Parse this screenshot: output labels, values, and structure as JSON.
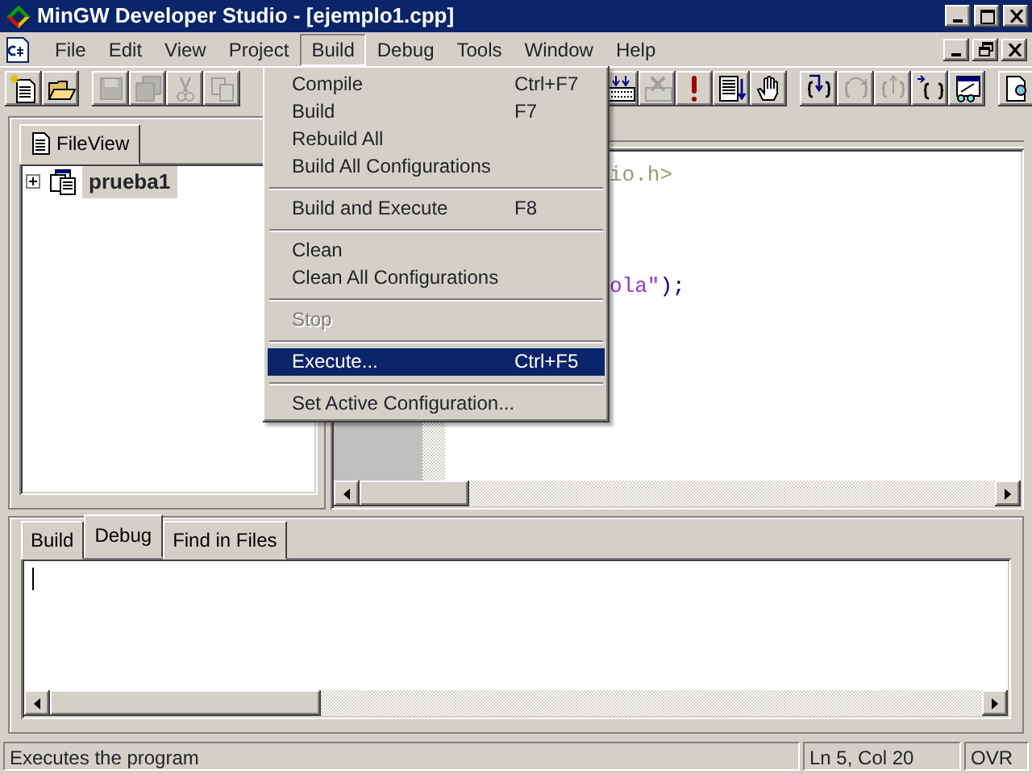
{
  "window": {
    "title": "MinGW Developer Studio - [ejemplo1.cpp]"
  },
  "menu_bar": [
    {
      "label": "File",
      "selected": false
    },
    {
      "label": "Edit",
      "selected": false
    },
    {
      "label": "View",
      "selected": false
    },
    {
      "label": "Project",
      "selected": false
    },
    {
      "label": "Build",
      "selected": true
    },
    {
      "label": "Debug",
      "selected": false
    },
    {
      "label": "Tools",
      "selected": false
    },
    {
      "label": "Window",
      "selected": false
    },
    {
      "label": "Help",
      "selected": false
    }
  ],
  "toolbar_left": [
    {
      "kind": "new",
      "disabled": false
    },
    {
      "kind": "open",
      "disabled": false
    },
    {
      "kind": "save",
      "disabled": true
    },
    {
      "kind": "saveall",
      "disabled": true
    },
    {
      "kind": "cut",
      "disabled": true
    },
    {
      "kind": "copy",
      "disabled": true
    }
  ],
  "toolbar_right": [
    {
      "kind": "build",
      "disabled": false
    },
    {
      "kind": "stopbuild",
      "disabled": true
    },
    {
      "kind": "execute",
      "disabled": false
    },
    {
      "kind": "docdown",
      "disabled": false
    },
    {
      "kind": "hand",
      "disabled": false
    },
    {
      "kind": "stepinto",
      "disabled": false
    },
    {
      "kind": "stepover",
      "disabled": true
    },
    {
      "kind": "stepout",
      "disabled": true
    },
    {
      "kind": "runcursor",
      "disabled": false
    },
    {
      "kind": "watch",
      "disabled": false
    },
    {
      "kind": "page",
      "disabled": false
    }
  ],
  "build_menu": [
    {
      "kind": "item",
      "label": "Compile",
      "shortcut": "Ctrl+F7",
      "disabled": false,
      "selected": false
    },
    {
      "kind": "item",
      "label": "Build",
      "shortcut": "F7",
      "disabled": false,
      "selected": false
    },
    {
      "kind": "item",
      "label": "Rebuild All",
      "disabled": false,
      "selected": false
    },
    {
      "kind": "item",
      "label": "Build All Configurations",
      "disabled": false,
      "selected": false
    },
    {
      "kind": "separator"
    },
    {
      "kind": "item",
      "label": "Build and Execute",
      "shortcut": "F8",
      "disabled": false,
      "selected": false
    },
    {
      "kind": "separator"
    },
    {
      "kind": "item",
      "label": "Clean",
      "disabled": false,
      "selected": false
    },
    {
      "kind": "item",
      "label": "Clean All Configurations",
      "disabled": false,
      "selected": false
    },
    {
      "kind": "separator"
    },
    {
      "kind": "item",
      "label": "Stop",
      "disabled": true,
      "selected": false
    },
    {
      "kind": "separator"
    },
    {
      "kind": "item",
      "label": "Execute...",
      "shortcut": "Ctrl+F5",
      "disabled": false,
      "selected": true
    },
    {
      "kind": "separator"
    },
    {
      "kind": "item",
      "label": "Set Active Configuration...",
      "disabled": false,
      "selected": false
    }
  ],
  "workspace": {
    "tabs": [
      {
        "label": "FileView",
        "selected": true
      }
    ],
    "tree": [
      {
        "label": "prueba1",
        "expanded": false,
        "selected": true
      }
    ]
  },
  "editor": {
    "lines": [
      {
        "segments": [
          {
            "kind": "preprocessor",
            "text": "io.h>"
          }
        ]
      },
      {
        "segments": [
          {
            "kind": "string",
            "text": "ola\""
          },
          {
            "kind": "punct",
            "text": ");"
          }
        ]
      }
    ]
  },
  "output": {
    "tabs": [
      {
        "label": "Build",
        "selected": false
      },
      {
        "label": "Debug",
        "selected": true
      },
      {
        "label": "Find in Files",
        "selected": false
      }
    ]
  },
  "status_bar": {
    "message": "Executes the program",
    "position": "Ln 5, Col 20",
    "mode": "OVR"
  }
}
